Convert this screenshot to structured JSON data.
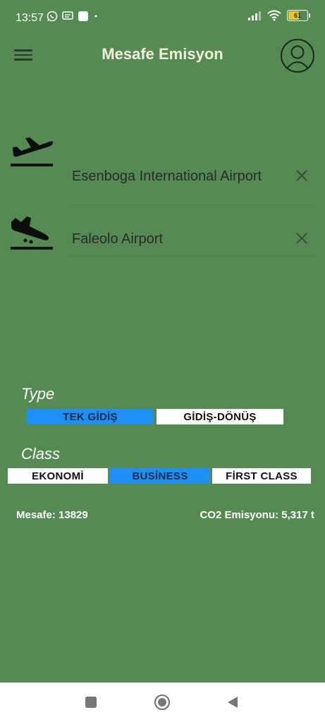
{
  "status_bar": {
    "time": "13:57",
    "battery_level": "61"
  },
  "app_bar": {
    "title": "Mesafe Emisyon"
  },
  "route": {
    "departure": {
      "value": "Esenboga International Airport"
    },
    "arrival": {
      "value": "Faleolo Airport"
    }
  },
  "trip_type": {
    "label": "Type",
    "options": [
      "TEK GİDİŞ",
      "GİDİŞ-DÖNÜŞ"
    ],
    "selected": "TEK GİDİŞ"
  },
  "travel_class": {
    "label": "Class",
    "options": [
      "EKONOMİ",
      "BUSİNESS",
      "FİRST CLASS"
    ],
    "selected": "BUSİNESS"
  },
  "results": {
    "distance": "Mesafe: 13829",
    "emission": "CO2 Emisyonu: 5,317 t"
  },
  "colors": {
    "background": "#558a52",
    "selected": "#1e90f5",
    "unselected": "#ffffff",
    "title": "#f2efdc"
  },
  "icons": [
    "whatsapp-icon",
    "message-icon",
    "notification-icon",
    "signal-icon",
    "wifi-icon",
    "battery-icon",
    "menu-icon",
    "profile-icon",
    "flight-takeoff-icon",
    "flight-land-icon",
    "close-icon",
    "recent-apps-icon",
    "home-icon",
    "back-icon"
  ]
}
